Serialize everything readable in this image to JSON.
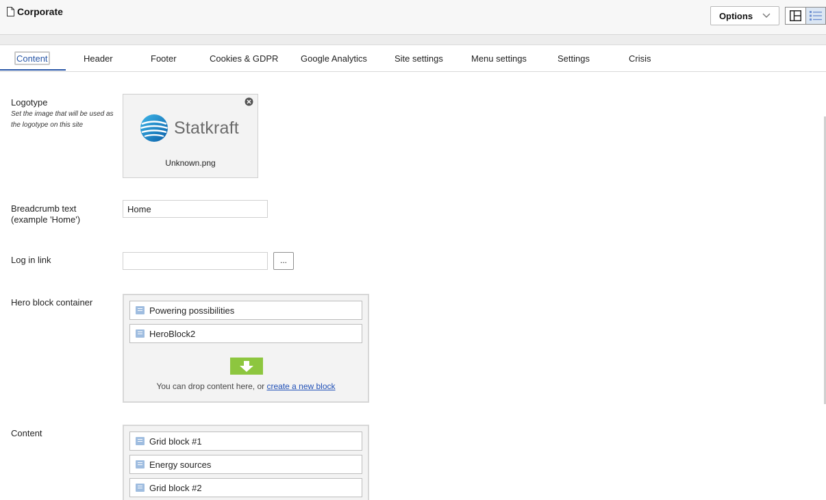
{
  "header": {
    "title": "Corporate",
    "doc_icon": "document-icon",
    "options_label": "Options",
    "options_icon": "chevron-down-icon",
    "view_icons": [
      "two-pane-layout-icon",
      "list-view-icon"
    ]
  },
  "tabs": [
    {
      "label": "Content",
      "active": true
    },
    {
      "label": "Header"
    },
    {
      "label": "Footer"
    },
    {
      "label": "Cookies & GDPR"
    },
    {
      "label": "Google Analytics"
    },
    {
      "label": "Site settings"
    },
    {
      "label": "Menu settings"
    },
    {
      "label": "Settings"
    },
    {
      "label": "Crisis"
    }
  ],
  "fields": {
    "logotype": {
      "label": "Logotype",
      "hint": "Set the image that will be used as the logotype on this site",
      "logo_text": "Statkraft",
      "filename": "Unknown.png"
    },
    "breadcrumb": {
      "label_line1": "Breadcrumb text",
      "label_line2": "(example 'Home')",
      "value": "Home"
    },
    "login_link": {
      "label": "Log in link",
      "value": "",
      "browse_label": "..."
    },
    "hero": {
      "label": "Hero block container",
      "items": [
        "Powering possibilities",
        "HeroBlock2"
      ],
      "drop_text": "You can drop content here, or ",
      "create_link": "create a new block"
    },
    "content": {
      "label": "Content",
      "items": [
        "Grid block #1",
        "Energy sources",
        "Grid block #2"
      ]
    }
  },
  "colors": {
    "accent": "#2856a6",
    "drop_green": "#8dc63f",
    "block_icon": "#9fbde0"
  }
}
